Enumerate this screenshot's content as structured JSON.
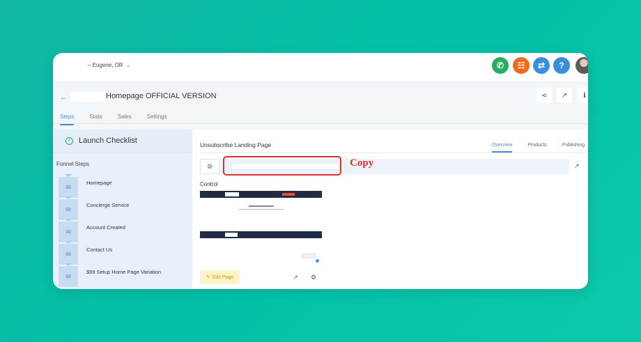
{
  "topbar": {
    "location": "– Eugene, OR",
    "buttons": [
      {
        "name": "phone-icon",
        "glyph": "✆",
        "color": "#27ae60"
      },
      {
        "name": "list-icon",
        "glyph": "☷",
        "color": "#f26b1d"
      },
      {
        "name": "swap-icon",
        "glyph": "⇄",
        "color": "#3b8de0"
      },
      {
        "name": "help-icon",
        "glyph": "?",
        "color": "#3b8de0"
      }
    ]
  },
  "header": {
    "title": "Homepage OFFICIAL VERSION",
    "tabs": [
      "Steps",
      "Stats",
      "Sales",
      "Settings"
    ],
    "active_tab": "Steps"
  },
  "sidebar": {
    "checklist_label": "Launch Checklist",
    "funnel_title": "Funnel Steps",
    "steps": [
      "Homepage",
      "Concierge Service",
      "Account Created",
      "Contact Us",
      "$99 Setup Home Page Variation"
    ]
  },
  "main": {
    "title": "Unsubscribe Landing Page",
    "tabs": [
      "Overview",
      "Products",
      "Publishing"
    ],
    "active_tab": "Overview",
    "annotation": "Copy",
    "control_label": "Control",
    "edit_button": "Edit Page",
    "accent_color": "#4a90d9",
    "highlight_color": "#d9322c"
  }
}
